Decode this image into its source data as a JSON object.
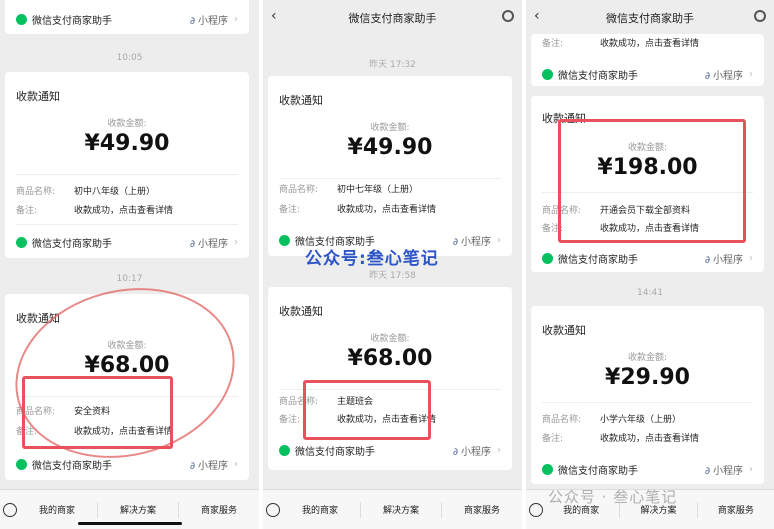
{
  "app": {
    "nav_title": "微信支付商家助手"
  },
  "common": {
    "card_title": "收款通知",
    "amount_label": "收款金额:",
    "product_key": "商品名称:",
    "remark_key": "备注:",
    "remark_value": "收款成功，点击查看详情",
    "merchant_name": "微信支付商家助手",
    "mini_label": "小程序",
    "link_glyph": "∂",
    "chevron": "›"
  },
  "panel1": {
    "time1": "10:05",
    "time2": "10:17",
    "cards": [
      {
        "amount": "¥49.90",
        "product": "初中八年级（上册）"
      },
      {
        "amount": "¥68.00",
        "product": "安全资料"
      }
    ]
  },
  "panel2": {
    "time_top": "昨天 17:32",
    "time_mid": "昨天 17:58",
    "cards": [
      {
        "amount": "¥49.90",
        "product": "初中七年级（上册）"
      },
      {
        "amount": "¥68.00",
        "product": "主题班会"
      }
    ]
  },
  "panel3": {
    "time_mid": "14:41",
    "cards": [
      {
        "amount": "¥198.00",
        "product": "开通会员下载全部资料"
      },
      {
        "amount": "¥29.90",
        "product": "小学六年级（上册）"
      }
    ]
  },
  "tabbar": {
    "tab1": "我的商家",
    "tab2": "解决方案",
    "tab3": "商家服务"
  },
  "watermark": {
    "text": "公众号:叁心笔记",
    "text2": "公众号 · 叁心笔记"
  },
  "colors": {
    "highlight": "#e8525d",
    "wechat_green": "#07c160",
    "link": "#576b95"
  }
}
